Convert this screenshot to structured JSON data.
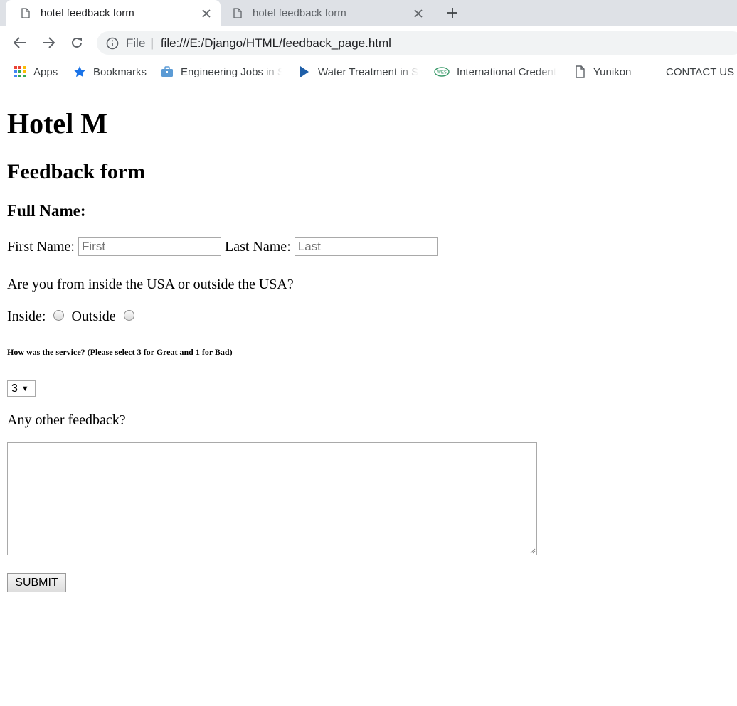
{
  "browser": {
    "tabs": [
      {
        "title": "hotel feedback form",
        "active": true
      },
      {
        "title": "hotel feedback form",
        "active": false
      }
    ],
    "address": {
      "scheme": "File",
      "url": "file:///E:/Django/HTML/feedback_page.html"
    },
    "bookmarks": [
      "Apps",
      "Bookmarks",
      "Engineering Jobs in S",
      "Water Treatment in S",
      "International Credent",
      "Yunikon",
      "CONTACT US"
    ]
  },
  "page": {
    "title": "Hotel M",
    "subtitle": "Feedback form",
    "full_name_heading": "Full Name:",
    "first_name_label": "First Name:",
    "first_name_placeholder": "First",
    "first_name_value": "",
    "last_name_label": "Last Name:",
    "last_name_placeholder": "Last",
    "last_name_value": "",
    "location_question": "Are you from inside the USA or outside the USA?",
    "inside_label": "Inside:",
    "outside_label": "Outside",
    "service_question": "How was the service? (Please select 3 for Great and 1 for Bad)",
    "service_rating_selected": "3",
    "other_feedback_label": "Any other feedback?",
    "feedback_text": "",
    "submit_label": "SUBMIT"
  },
  "colors": {
    "tabstrip": "#dee1e6",
    "omnibox": "#f1f3f4",
    "bookmark_star": "#1a73e8",
    "apps_red": "#ea4335",
    "apps_yellow": "#fbbc04",
    "apps_green": "#34a853",
    "apps_blue": "#4285f4"
  }
}
